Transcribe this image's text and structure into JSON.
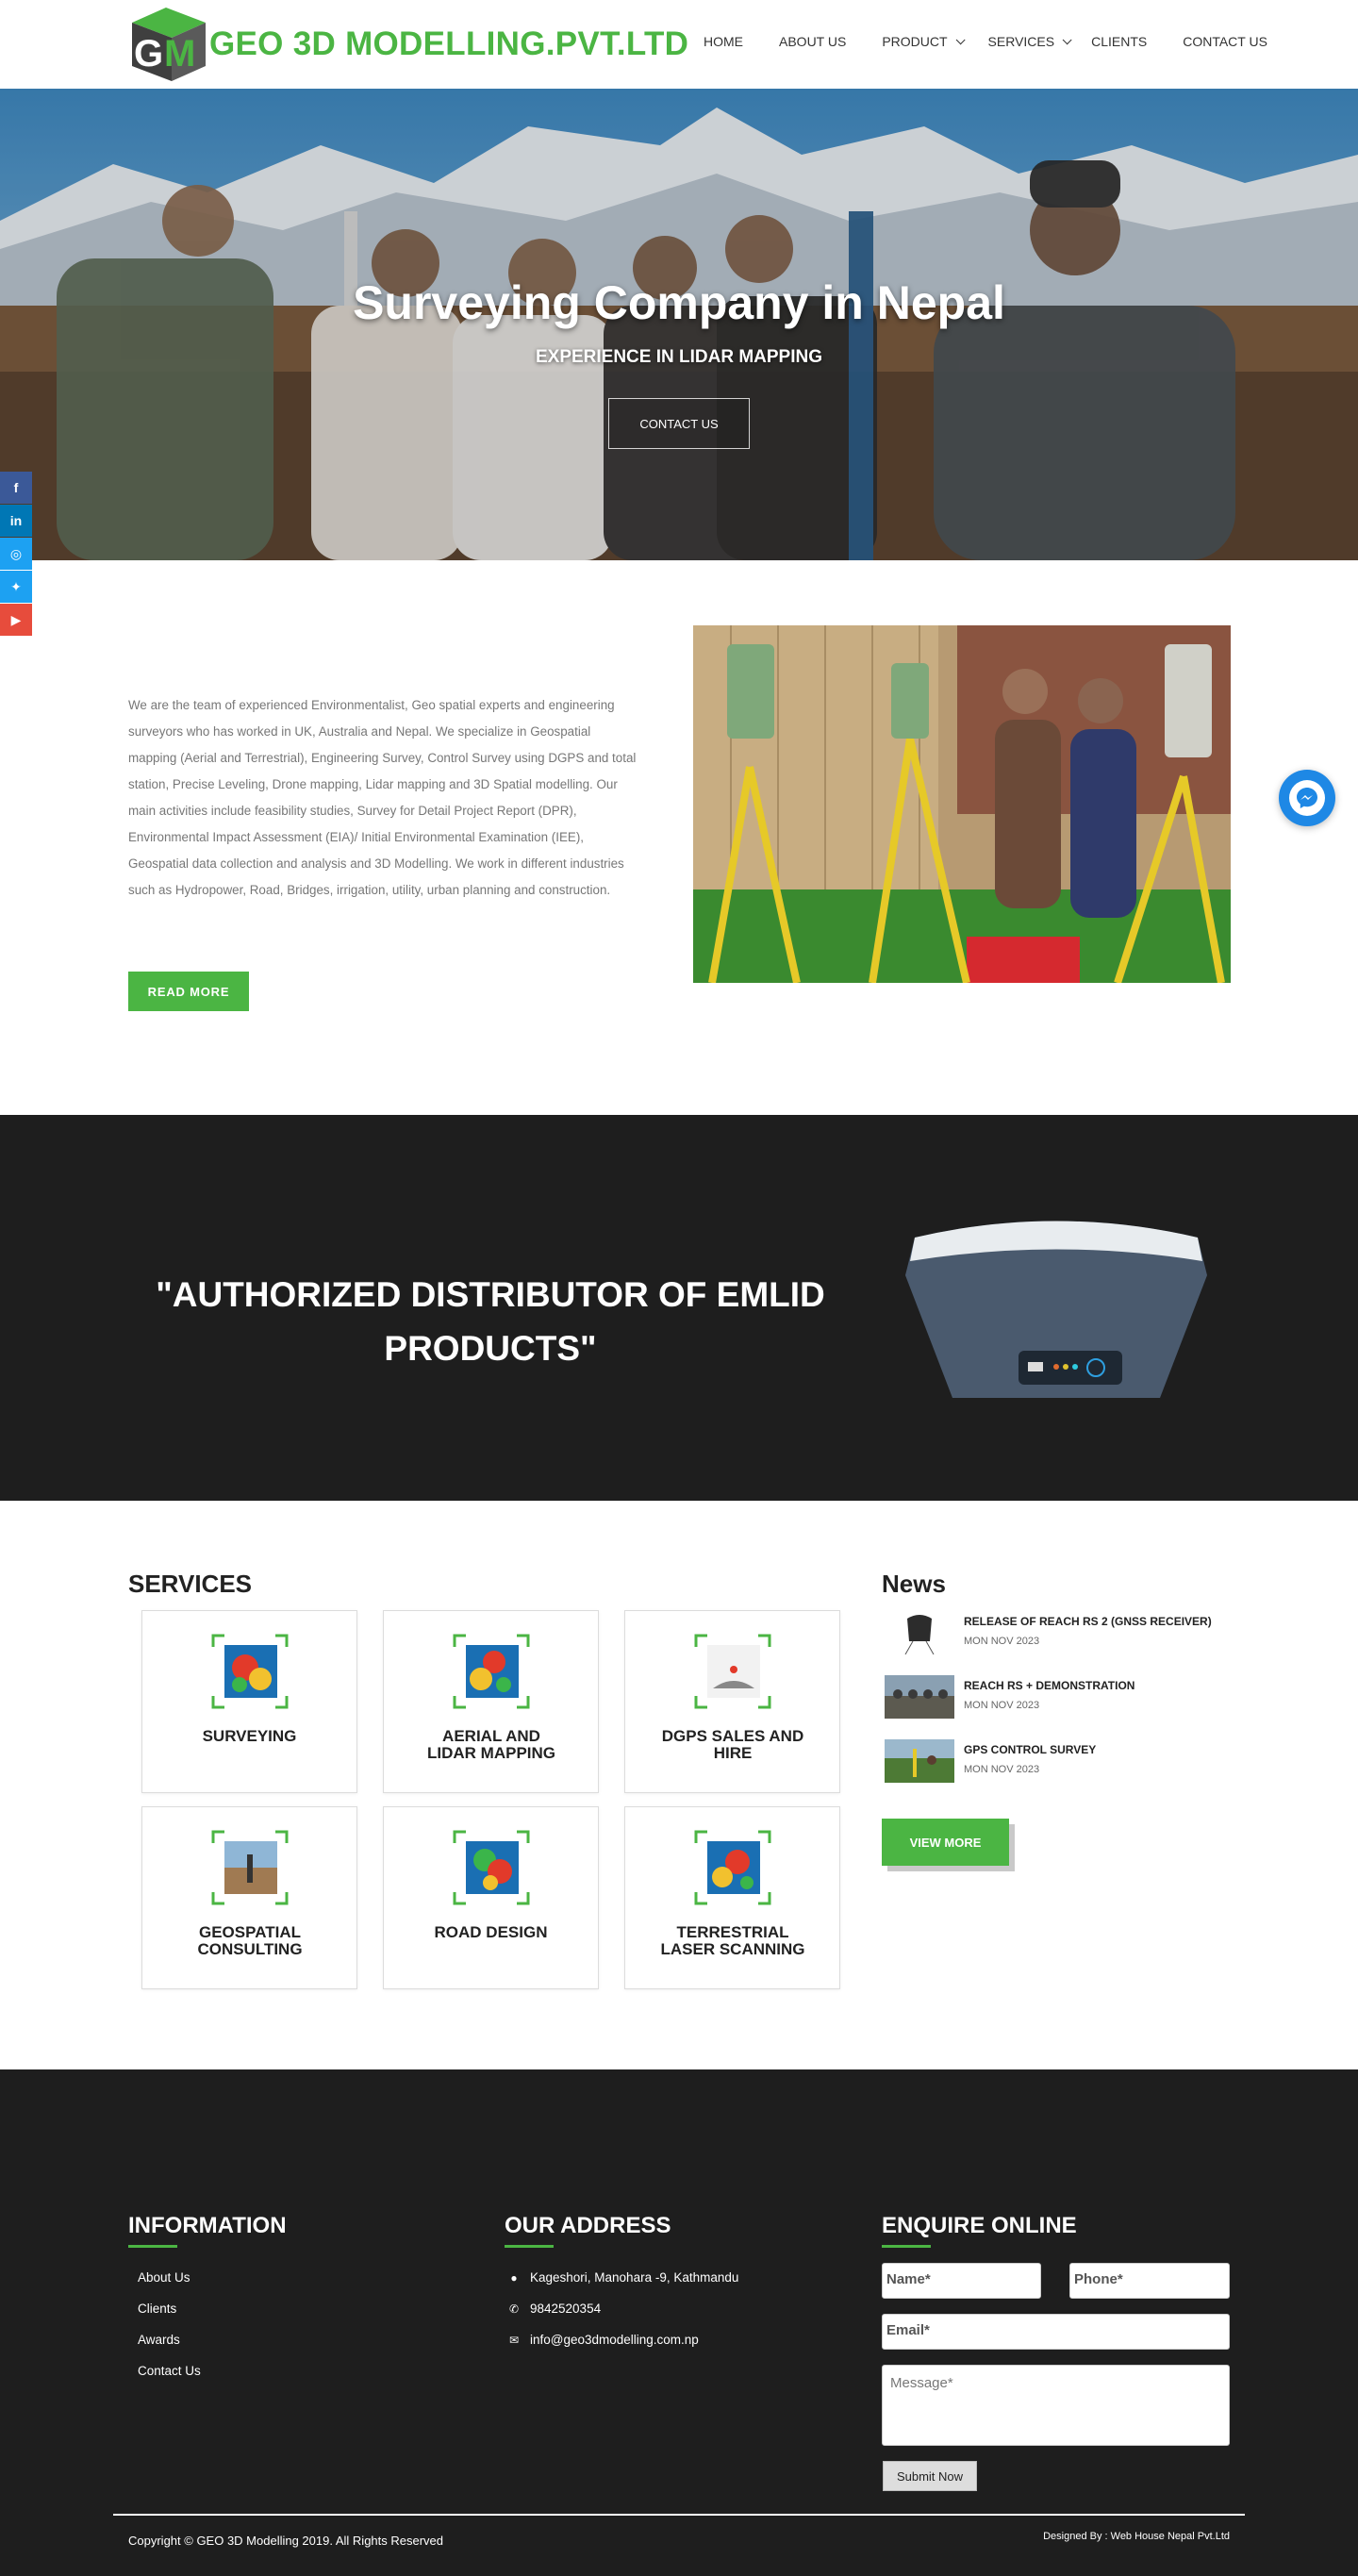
{
  "header": {
    "logo_letters": "GM",
    "brand": "GEO 3D MODELLING.PVT.LTD",
    "nav": [
      {
        "label": "HOME",
        "dropdown": false
      },
      {
        "label": "ABOUT US",
        "dropdown": false
      },
      {
        "label": "PRODUCT",
        "dropdown": true
      },
      {
        "label": "SERVICES",
        "dropdown": true
      },
      {
        "label": "CLIENTS",
        "dropdown": false
      },
      {
        "label": "CONTACT US",
        "dropdown": false
      }
    ]
  },
  "hero": {
    "title": "Surveying Company in Nepal",
    "subtitle": "EXPERIENCE IN LIDAR MAPPING",
    "button": "CONTACT US"
  },
  "social": [
    {
      "icon": "facebook-icon",
      "glyph": "f",
      "color": "#3b5998"
    },
    {
      "icon": "linkedin-icon",
      "glyph": "in",
      "color": "#0077b5"
    },
    {
      "icon": "instagram-icon",
      "glyph": "◎",
      "color": "#1da1f2"
    },
    {
      "icon": "twitter-icon",
      "glyph": "✦",
      "color": "#1da1f2"
    },
    {
      "icon": "youtube-icon",
      "glyph": "▶",
      "color": "#e74c3c"
    }
  ],
  "about": {
    "text": "We are the team of experienced Environmentalist, Geo spatial experts and engineering surveyors who has worked in UK, Australia and Nepal. We specialize in Geospatial mapping (Aerial and Terrestrial), Engineering Survey, Control Survey using DGPS and total station, Precise Leveling, Drone mapping, Lidar mapping and 3D Spatial modelling. Our main activities include feasibility studies, Survey for Detail Project Report (DPR), Environmental Impact Assessment (EIA)/ Initial Environmental Examination (IEE), Geospatial data collection and analysis and 3D Modelling. We work in different industries such as Hydropower, Road, Bridges, irrigation, utility, urban planning and construction.",
    "button": "READ MORE"
  },
  "emlid": {
    "text": "\"AUTHORIZED DISTRIBUTOR OF EMLID PRODUCTS\""
  },
  "services": {
    "title": "SERVICES",
    "items": [
      {
        "label": "SURVEYING",
        "icon": "map-thumbnail-icon"
      },
      {
        "label": "AERIAL AND LIDAR MAPPING",
        "icon": "map-thumbnail-icon"
      },
      {
        "label": "DGPS SALES AND HIRE",
        "icon": "device-thumbnail-icon"
      },
      {
        "label": "GEOSPATIAL CONSULTING",
        "icon": "photo-thumbnail-icon"
      },
      {
        "label": "ROAD DESIGN",
        "icon": "map-thumbnail-icon"
      },
      {
        "label": "TERRESTRIAL LASER SCANNING",
        "icon": "map-thumbnail-icon"
      }
    ]
  },
  "news": {
    "title": "News",
    "items": [
      {
        "title": "RELEASE OF REACH RS 2 (GNSS RECEIVER)",
        "date": "MON NOV 2023"
      },
      {
        "title": "REACH RS + DEMONSTRATION",
        "date": "MON NOV 2023"
      },
      {
        "title": "GPS CONTROL SURVEY",
        "date": "MON NOV 2023"
      }
    ],
    "button": "VIEW MORE"
  },
  "footer": {
    "info_title": "INFORMATION",
    "info_links": [
      "About Us",
      "Clients",
      "Awards",
      "Contact Us"
    ],
    "address_title": "OUR ADDRESS",
    "address": "Kageshori, Manohara -9, Kathmandu",
    "phone": "9842520354",
    "email": "info@geo3dmodelling.com.np",
    "enquire_title": "ENQUIRE ONLINE",
    "name_placeholder": "Name*",
    "phone_placeholder": "Phone*",
    "email_placeholder": "Email*",
    "message_placeholder": "Message*",
    "submit": "Submit Now",
    "copyright": "Copyright © GEO 3D Modelling 2019. All Rights Reserved",
    "designer": "Designed By : Web House Nepal Pvt.Ltd"
  },
  "colors": {
    "accent": "#4bb543",
    "dark": "#1e1e1e"
  }
}
